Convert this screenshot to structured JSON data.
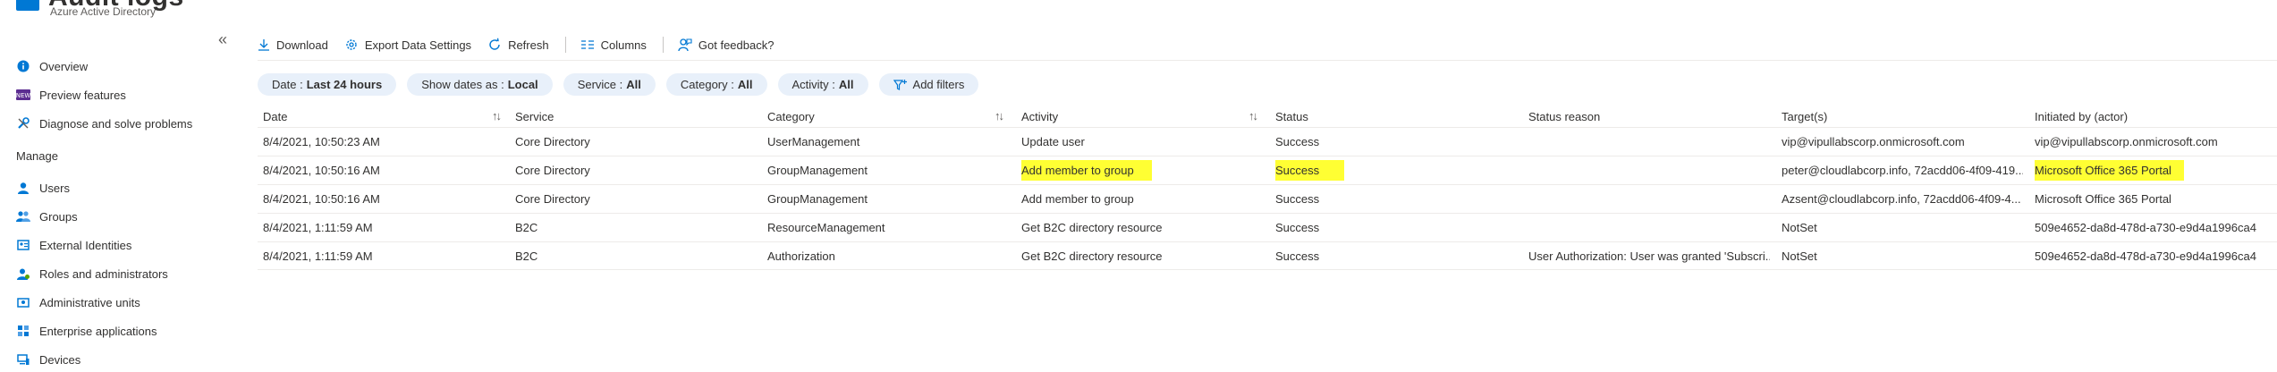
{
  "header": {
    "title": "Audit logs",
    "subtitle": "Azure Active Directory"
  },
  "sidebar": {
    "collapse_label": "«",
    "items": [
      {
        "label": "Overview",
        "icon": "info-icon"
      },
      {
        "label": "Preview features",
        "icon": "preview-icon"
      },
      {
        "label": "Diagnose and solve problems",
        "icon": "wrench-icon"
      }
    ],
    "manage_heading": "Manage",
    "manage_items": [
      {
        "label": "Users",
        "icon": "user-icon"
      },
      {
        "label": "Groups",
        "icon": "group-icon"
      },
      {
        "label": "External Identities",
        "icon": "external-identities-icon"
      },
      {
        "label": "Roles and administrators",
        "icon": "roles-icon"
      },
      {
        "label": "Administrative units",
        "icon": "admin-units-icon"
      },
      {
        "label": "Enterprise applications",
        "icon": "enterprise-apps-icon"
      },
      {
        "label": "Devices",
        "icon": "devices-icon"
      }
    ]
  },
  "toolbar": {
    "download": "Download",
    "export": "Export Data Settings",
    "refresh": "Refresh",
    "columns": "Columns",
    "feedback": "Got feedback?"
  },
  "filters": [
    {
      "label": "Date :",
      "value": "Last 24 hours"
    },
    {
      "label": "Show dates as :",
      "value": "Local"
    },
    {
      "label": "Service :",
      "value": "All"
    },
    {
      "label": "Category :",
      "value": "All"
    },
    {
      "label": "Activity :",
      "value": "All"
    }
  ],
  "add_filters": "Add filters",
  "table": {
    "columns": [
      "Date",
      "Service",
      "Category",
      "Activity",
      "Status",
      "Status reason",
      "Target(s)",
      "Initiated by (actor)"
    ],
    "rows": [
      {
        "date": "8/4/2021, 10:50:23 AM",
        "service": "Core Directory",
        "category": "UserManagement",
        "activity": "Update user",
        "status": "Success",
        "reason": "",
        "targets": "vip@vipullabscorp.onmicrosoft.com",
        "initiated_by": "vip@vipullabscorp.onmicrosoft.com"
      },
      {
        "date": "8/4/2021, 10:50:16 AM",
        "service": "Core Directory",
        "category": "GroupManagement",
        "activity": "Add member to group",
        "status": "Success",
        "reason": "",
        "targets": "peter@cloudlabcorp.info, 72acdd06-4f09-419...",
        "initiated_by": "Microsoft Office 365 Portal"
      },
      {
        "date": "8/4/2021, 10:50:16 AM",
        "service": "Core Directory",
        "category": "GroupManagement",
        "activity": "Add member to group",
        "status": "Success",
        "reason": "",
        "targets": "Azsent@cloudlabcorp.info, 72acdd06-4f09-4...",
        "initiated_by": "Microsoft Office 365 Portal"
      },
      {
        "date": "8/4/2021, 1:11:59 AM",
        "service": "B2C",
        "category": "ResourceManagement",
        "activity": "Get B2C directory resource",
        "status": "Success",
        "reason": "",
        "targets": "NotSet",
        "initiated_by": "509e4652-da8d-478d-a730-e9d4a1996ca4"
      },
      {
        "date": "8/4/2021, 1:11:59 AM",
        "service": "B2C",
        "category": "Authorization",
        "activity": "Get B2C directory resource",
        "status": "Success",
        "reason": "User Authorization: User was granted 'Subscri...",
        "targets": "NotSet",
        "initiated_by": "509e4652-da8d-478d-a730-e9d4a1996ca4"
      }
    ]
  },
  "colors": {
    "accent": "#0078d4",
    "pill_bg": "#e8f0fa",
    "highlight": "#ffff33",
    "divider": "#edebe9"
  }
}
